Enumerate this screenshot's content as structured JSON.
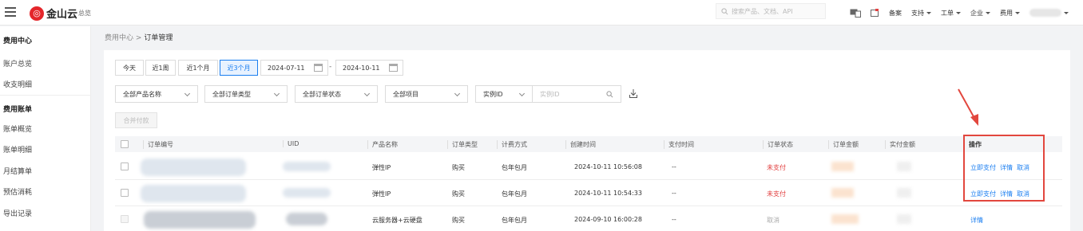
{
  "header": {
    "logo_mark": "◎",
    "logo_text": "金山云",
    "logo_sub": "总览",
    "search_placeholder": "搜索产品、文档、API",
    "nav": [
      {
        "label": "备案",
        "dropdown": false
      },
      {
        "label": "支持",
        "dropdown": true
      },
      {
        "label": "工单",
        "dropdown": true
      },
      {
        "label": "企业",
        "dropdown": true
      },
      {
        "label": "费用",
        "dropdown": true
      }
    ]
  },
  "sidebar": {
    "section1_title": "费用中心",
    "item_overview": "账户总览",
    "item_income": "收支明细",
    "section2_title": "费用账单",
    "item_bill_overview": "账单概览",
    "item_bill_detail": "账单明细",
    "item_monthly": "月结算单",
    "item_estimate": "预估消耗",
    "item_export": "导出记录"
  },
  "breadcrumb": {
    "parent": "费用中心",
    "separator": ">",
    "current": "订单管理"
  },
  "filters": {
    "quick_ranges": [
      "今天",
      "近1周",
      "近1个月",
      "近3个月"
    ],
    "active_range": "近3个月",
    "date_start": "2024-07-11",
    "date_separator": "-",
    "date_end": "2024-10-11",
    "product_select": "全部产品名称",
    "order_type_select": "全部订单类型",
    "order_status_select": "全部订单状态",
    "project_select": "全部项目",
    "id_type_select": "实例ID",
    "id_input_placeholder": "实例ID"
  },
  "merge_pay_label": "合并付款",
  "table": {
    "headers": {
      "order_no": "订单编号",
      "uid": "UID",
      "product": "产品名称",
      "order_type": "订单类型",
      "billing": "计费方式",
      "created": "创建时间",
      "paid_time": "支付时间",
      "status": "订单状态",
      "order_amount": "订单金额",
      "actual_amount": "实付金额",
      "actions": "操作"
    },
    "rows": [
      {
        "product": "弹性IP",
        "order_type": "购买",
        "billing": "包年包月",
        "created": "2024-10-11 10:56:08",
        "paid_time": "--",
        "status": "未支付",
        "status_color": "#e24040",
        "action_pay": "立即支付",
        "action_detail": "详情",
        "action_cancel": "取消"
      },
      {
        "product": "弹性IP",
        "order_type": "购买",
        "billing": "包年包月",
        "created": "2024-10-11 10:54:33",
        "paid_time": "--",
        "status": "未支付",
        "status_color": "#e24040",
        "action_pay": "立即支付",
        "action_detail": "详情",
        "action_cancel": "取消"
      },
      {
        "product": "云服务器+云硬盘",
        "order_type": "购买",
        "billing": "包年包月",
        "created": "2024-09-10 16:00:28",
        "paid_time": "--",
        "status": "取消",
        "status_color": "#aaaaaa",
        "action_detail": "详情"
      }
    ]
  },
  "colors": {
    "accent": "#1a7ef0",
    "danger": "#e24040",
    "annotation": "#e2473e"
  }
}
